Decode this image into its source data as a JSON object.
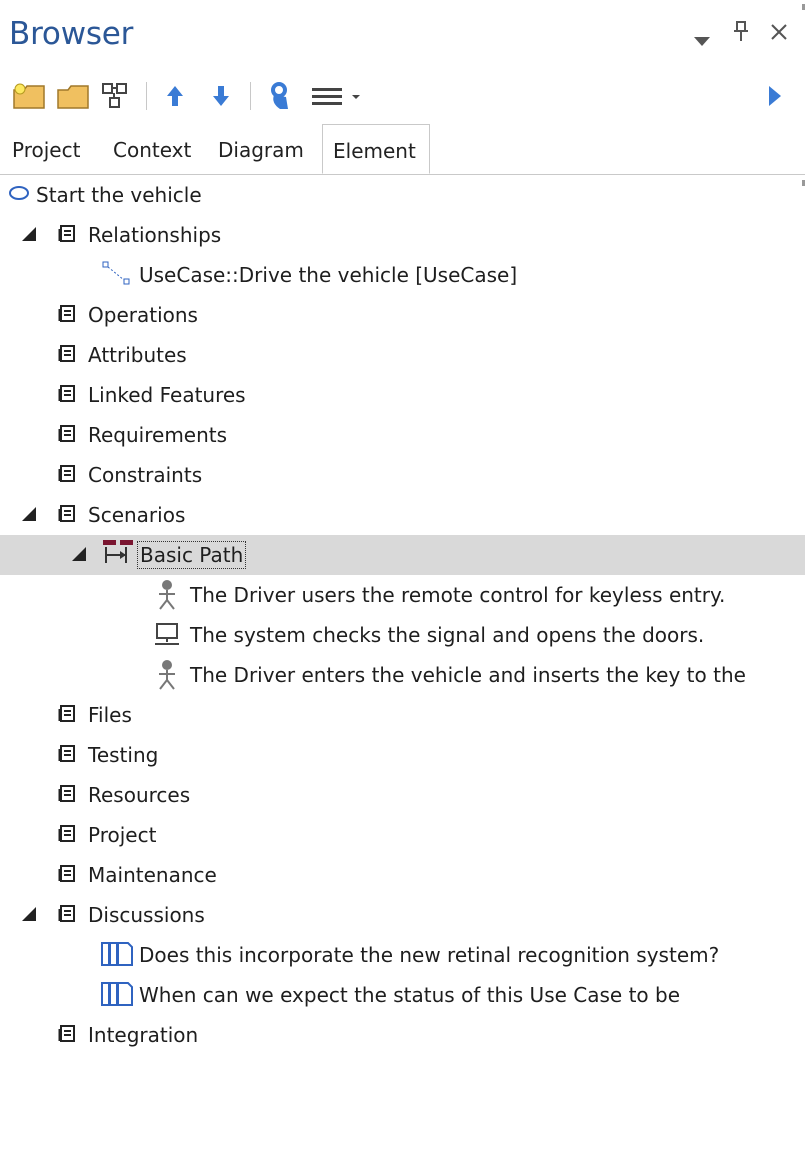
{
  "window": {
    "title": "Browser",
    "controls": [
      "▾",
      "ᵃ",
      "✕"
    ]
  },
  "toolbar": {
    "items": [
      {
        "name": "new-package-icon"
      },
      {
        "name": "folder-icon"
      },
      {
        "name": "new-diagram-icon"
      },
      {
        "name": "move-up-icon"
      },
      {
        "name": "move-down-icon"
      },
      {
        "name": "locate-icon"
      },
      {
        "name": "menu-icon"
      },
      {
        "name": "expand-right-icon"
      }
    ]
  },
  "tabs": [
    {
      "label": "Project"
    },
    {
      "label": "Context"
    },
    {
      "label": "Diagram"
    },
    {
      "label": "Element",
      "active": true
    }
  ],
  "tree": {
    "root": "Start the vehicle",
    "relationships": "Relationships",
    "relationship_item": "UseCase::Drive the vehicle [UseCase]",
    "operations": "Operations",
    "attributes": "Attributes",
    "linked_features": "Linked Features",
    "requirements": "Requirements",
    "constraints": "Constraints",
    "scenarios": "Scenarios",
    "basic_path": "Basic Path",
    "step1": "The Driver users the remote control for keyless entry.",
    "step2": "The system checks the signal and opens the doors.",
    "step3": "The Driver enters the vehicle and inserts the key to the",
    "files": "Files",
    "testing": "Testing",
    "resources": "Resources",
    "project": "Project",
    "maintenance": "Maintenance",
    "discussions": "Discussions",
    "discussion1": "Does this incorporate the new retinal recognition system?",
    "discussion2": "When can we expect the status of this Use Case to be",
    "integration": "Integration"
  },
  "colors": {
    "title": "#2b5797",
    "toolbar_blue": "#3a7bd5",
    "selected_row": "#d9d9d9"
  }
}
